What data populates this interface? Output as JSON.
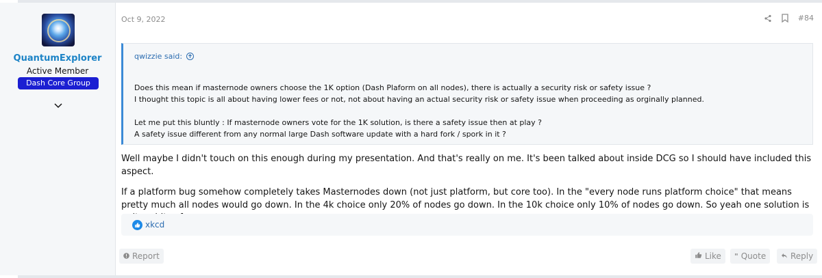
{
  "post": {
    "date": "Oct 9, 2022",
    "number": "#84"
  },
  "user": {
    "name": "QuantumExplorer",
    "title": "Active Member",
    "banner": "Dash Core Group"
  },
  "quote": {
    "author": "qwizzie said:",
    "lines": [
      "Does this mean if masternode owners choose the 1K option (Dash Plaform on all nodes), there is actually a security risk or safety issue ?",
      "I thought this topic is all about having lower fees or not, not about having an actual security risk or safety issue when proceeding as orginally planned.",
      "Let me put this bluntly : If masternode owners vote for the 1K solution, is there a safety issue then at play ?",
      "A safety issue different from any normal large Dash software update with a hard fork / spork in it ?"
    ]
  },
  "message": {
    "paragraphs": [
      "Well maybe I didn't touch on this enough during my presentation. And that's really on me. It's been talked about inside DCG so I should have included this aspect.",
      "If a platform bug somehow completely takes Masternodes down (not just platform, but core too). In the \"every node runs platform choice\" that means pretty much all nodes would go down. In the 4k choice only 20% of nodes go down. In the 10k choice only 10% of nodes go down. So yeah one solution is quite a bit safer."
    ]
  },
  "reactions": {
    "users": "xkcd",
    "icon": "thumbs-up-icon"
  },
  "footer": {
    "report": "Report",
    "like": "Like",
    "quote": "Quote",
    "reply": "Reply"
  },
  "colors": {
    "username": "#1c83c6",
    "banner": "#1b1fd2",
    "quote_border": "#3b8ad6",
    "muted": "#8c8c8c"
  }
}
